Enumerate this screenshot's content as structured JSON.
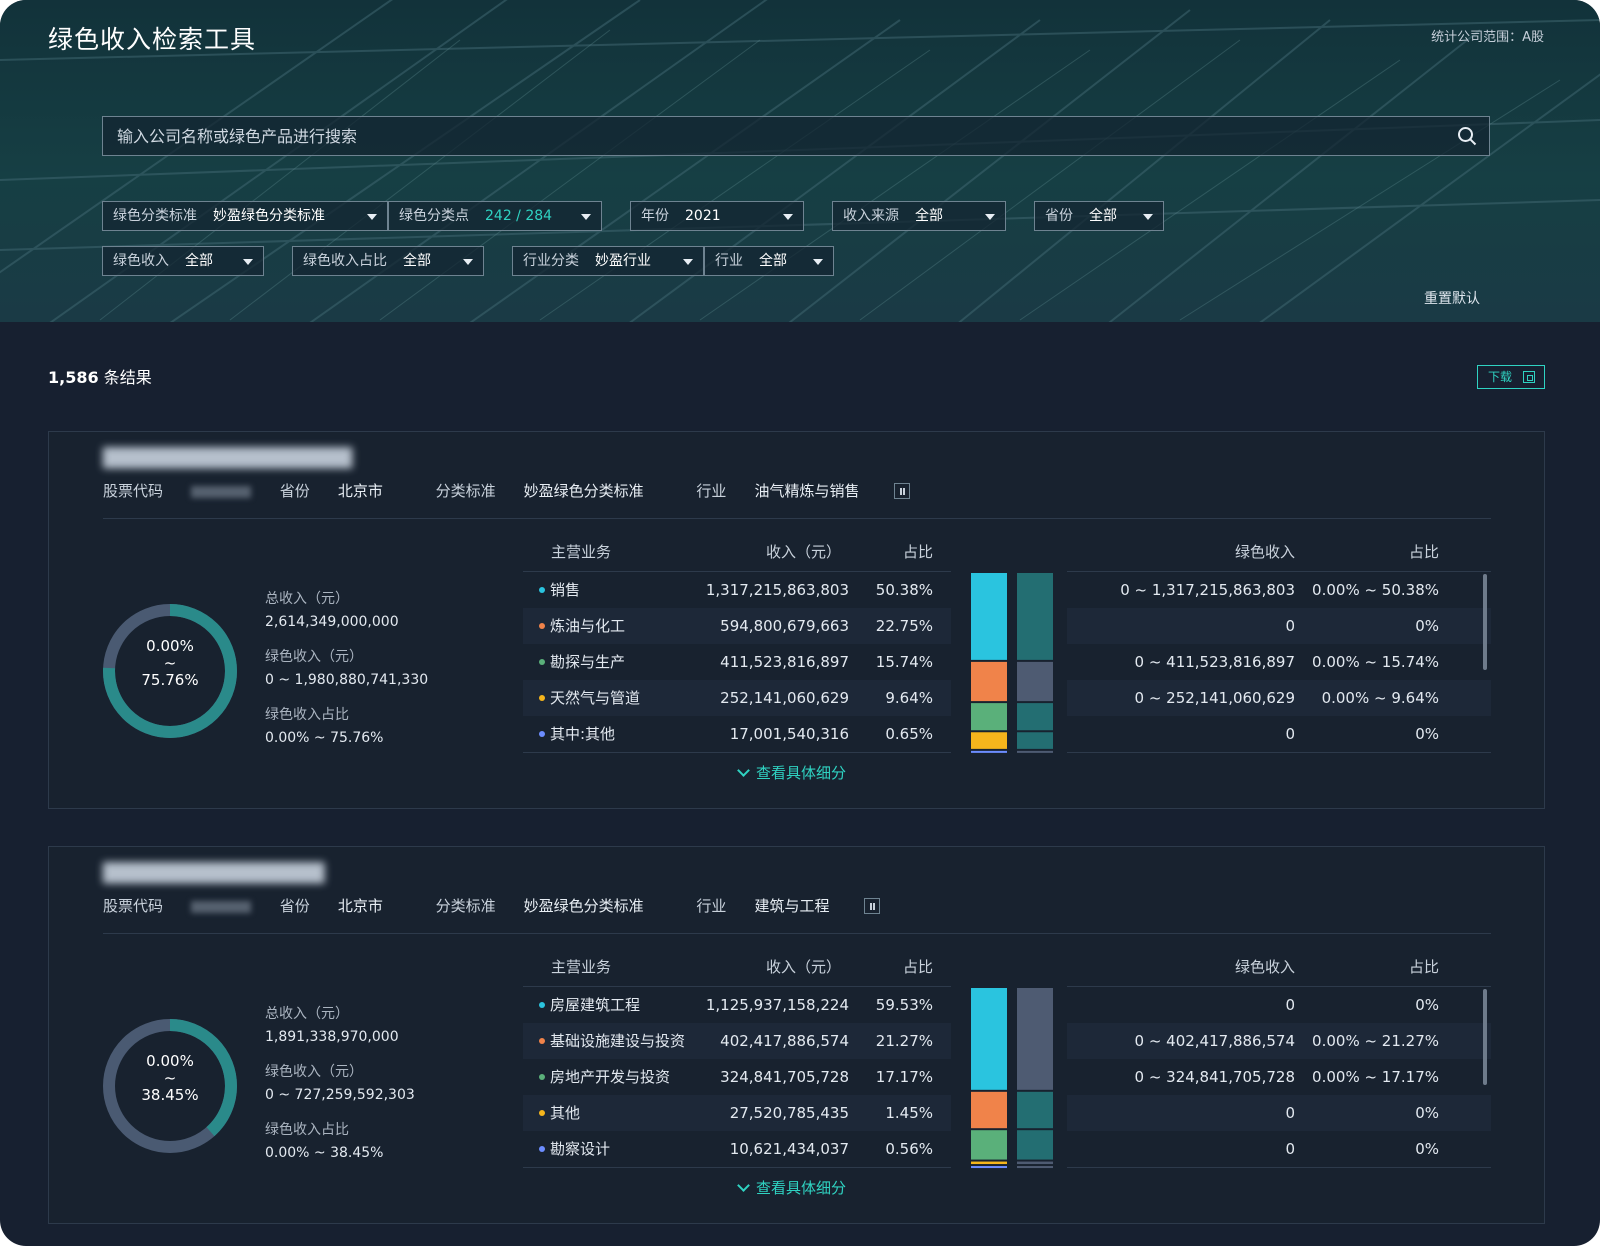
{
  "app": {
    "title": "绿色收入检索工具",
    "scope": "统计公司范围：A股"
  },
  "search": {
    "placeholder": "输入公司名称或绿色产品进行搜索"
  },
  "filters": [
    {
      "label": "绿色分类标准",
      "value": "妙盈绿色分类标准"
    },
    {
      "label": "绿色分类点",
      "value": "242 / 284"
    },
    {
      "label": "年份",
      "value": "2021"
    },
    {
      "label": "收入来源",
      "value": "全部"
    },
    {
      "label": "省份",
      "value": "全部"
    },
    {
      "label": "绿色收入",
      "value": "全部"
    },
    {
      "label": "绿色收入占比",
      "value": "全部"
    },
    {
      "label": "行业分类",
      "value": "妙盈行业"
    },
    {
      "label": "行业",
      "value": "全部"
    }
  ],
  "reset_label": "重置默认",
  "results": {
    "count": "1,586",
    "count_suffix": "条结果",
    "download_label": "下载"
  },
  "labels": {
    "stock_code": "股票代码",
    "province": "省份",
    "standard": "分类标准",
    "industry": "行业",
    "total_revenue": "总收入（元）",
    "green_revenue": "绿色收入（元）",
    "green_ratio": "绿色收入占比",
    "col_business": "主营业务",
    "col_revenue": "收入（元）",
    "col_share": "占比",
    "col_green_revenue": "绿色收入",
    "col_green_share": "占比",
    "expand": "查看具体细分"
  },
  "colors": {
    "accent": "#2fd3c2",
    "dot_1": "#2ac4df",
    "dot_2": "#f0834a",
    "dot_3": "#5ab07a",
    "dot_4": "#f5b51c",
    "dot_5": "#6c8dff"
  },
  "companies": [
    {
      "province": "北京市",
      "standard": "妙盈绿色分类标准",
      "industry": "油气精炼与销售",
      "donut_low": "0.00%",
      "donut_sep": "~",
      "donut_high": "75.76%",
      "donut_ratio": 0.7576,
      "total_revenue": "2,614,349,000,000",
      "green_revenue": "0 ~ 1,980,880,741,330",
      "green_ratio": "0.00% ~ 75.76%",
      "rows": [
        {
          "name": "销售",
          "revenue": "1,317,215,863,803",
          "share": "50.38%",
          "green_revenue": "0 ~ 1,317,215,863,803",
          "green_share": "0.00% ~ 50.38%"
        },
        {
          "name": "炼油与化工",
          "revenue": "594,800,679,663",
          "share": "22.75%",
          "green_revenue": "0",
          "green_share": "0%"
        },
        {
          "name": "勘探与生产",
          "revenue": "411,523,816,897",
          "share": "15.74%",
          "green_revenue": "0 ~ 411,523,816,897",
          "green_share": "0.00% ~ 15.74%"
        },
        {
          "name": "天然气与管道",
          "revenue": "252,141,060,629",
          "share": "9.64%",
          "green_revenue": "0 ~ 252,141,060,629",
          "green_share": "0.00% ~ 9.64%"
        },
        {
          "name": "其中:其他",
          "revenue": "17,001,540,316",
          "share": "0.65%",
          "green_revenue": "0",
          "green_share": "0%"
        }
      ],
      "shares": [
        50.38,
        22.75,
        15.74,
        9.64,
        0.65
      ],
      "green_flags": [
        true,
        false,
        true,
        true,
        false
      ]
    },
    {
      "province": "北京市",
      "standard": "妙盈绿色分类标准",
      "industry": "建筑与工程",
      "donut_low": "0.00%",
      "donut_sep": "~",
      "donut_high": "38.45%",
      "donut_ratio": 0.3845,
      "total_revenue": "1,891,338,970,000",
      "green_revenue": "0 ~ 727,259,592,303",
      "green_ratio": "0.00% ~ 38.45%",
      "rows": [
        {
          "name": "房屋建筑工程",
          "revenue": "1,125,937,158,224",
          "share": "59.53%",
          "green_revenue": "0",
          "green_share": "0%"
        },
        {
          "name": "基础设施建设与投资",
          "revenue": "402,417,886,574",
          "share": "21.27%",
          "green_revenue": "0 ~ 402,417,886,574",
          "green_share": "0.00% ~ 21.27%"
        },
        {
          "name": "房地产开发与投资",
          "revenue": "324,841,705,728",
          "share": "17.17%",
          "green_revenue": "0 ~ 324,841,705,728",
          "green_share": "0.00% ~ 17.17%"
        },
        {
          "name": "其他",
          "revenue": "27,520,785,435",
          "share": "1.45%",
          "green_revenue": "0",
          "green_share": "0%"
        },
        {
          "name": "勘察设计",
          "revenue": "10,621,434,037",
          "share": "0.56%",
          "green_revenue": "0",
          "green_share": "0%"
        }
      ],
      "shares": [
        59.53,
        21.27,
        17.17,
        1.45,
        0.56
      ],
      "green_flags": [
        false,
        true,
        true,
        false,
        false
      ]
    }
  ]
}
